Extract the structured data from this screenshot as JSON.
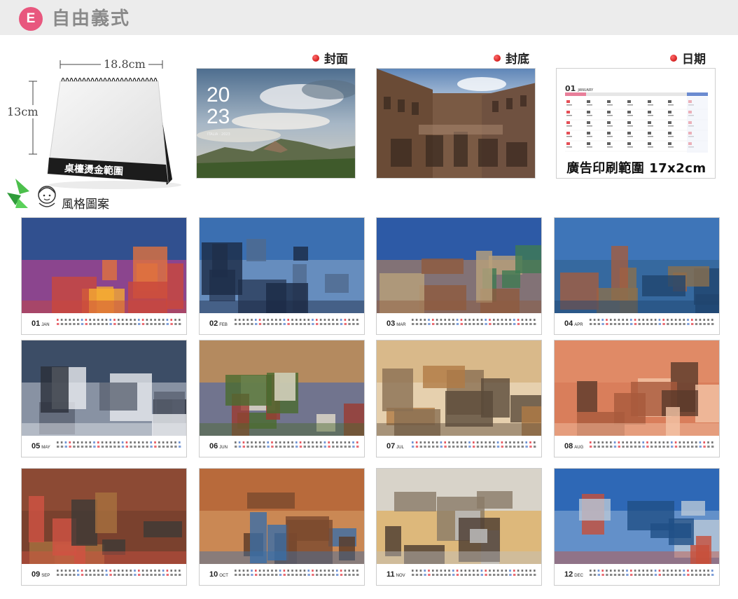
{
  "header": {
    "badge": "E",
    "title": "自由義式"
  },
  "product": {
    "width_label": "18.8cm",
    "height_label": "13cm",
    "base_label": "桌檯燙金範圍"
  },
  "legend": {
    "cover": "封面",
    "back": "封底",
    "date": "日期"
  },
  "cover_text": {
    "year_line1": "20",
    "year_line2": "23",
    "subtitle": "ITALIA · 2023"
  },
  "date_sample": {
    "month_num": "01",
    "month_name": "JANUARY",
    "print_range": "廣告印刷範圍 17x2cm"
  },
  "style_label": "風格圖案",
  "months": [
    {
      "num": "01",
      "name": "JAN"
    },
    {
      "num": "02",
      "name": "FEB"
    },
    {
      "num": "03",
      "name": "MAR"
    },
    {
      "num": "04",
      "name": "APR"
    },
    {
      "num": "05",
      "name": "MAY"
    },
    {
      "num": "06",
      "name": "JUN"
    },
    {
      "num": "07",
      "name": "JUL"
    },
    {
      "num": "08",
      "name": "AUG"
    },
    {
      "num": "09",
      "name": "SEP"
    },
    {
      "num": "10",
      "name": "OCT"
    },
    {
      "num": "11",
      "name": "NOV"
    },
    {
      "num": "12",
      "name": "DEC"
    }
  ],
  "colors": {
    "badge": "#e8577e",
    "dot": "#cc0000",
    "sunday": "#e0303a",
    "saturday": "#4a78c8"
  }
}
